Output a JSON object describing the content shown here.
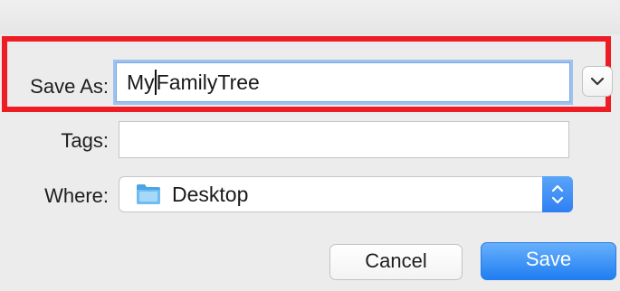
{
  "dialog": {
    "save_as": {
      "label": "Save As:",
      "value_before_caret": "My",
      "value_after_caret": "FamilyTree"
    },
    "tags": {
      "label": "Tags:",
      "value": ""
    },
    "where": {
      "label": "Where:",
      "selected": "Desktop"
    },
    "buttons": {
      "cancel": "Cancel",
      "save": "Save"
    }
  },
  "colors": {
    "highlight": "#ee1c24",
    "accent": "#2f7ff3",
    "focus_ring": "#9cc2f0"
  },
  "icons": {
    "expand": "chevron-down-icon",
    "folder": "folder-icon",
    "stepper": "up-down-arrows-icon"
  }
}
